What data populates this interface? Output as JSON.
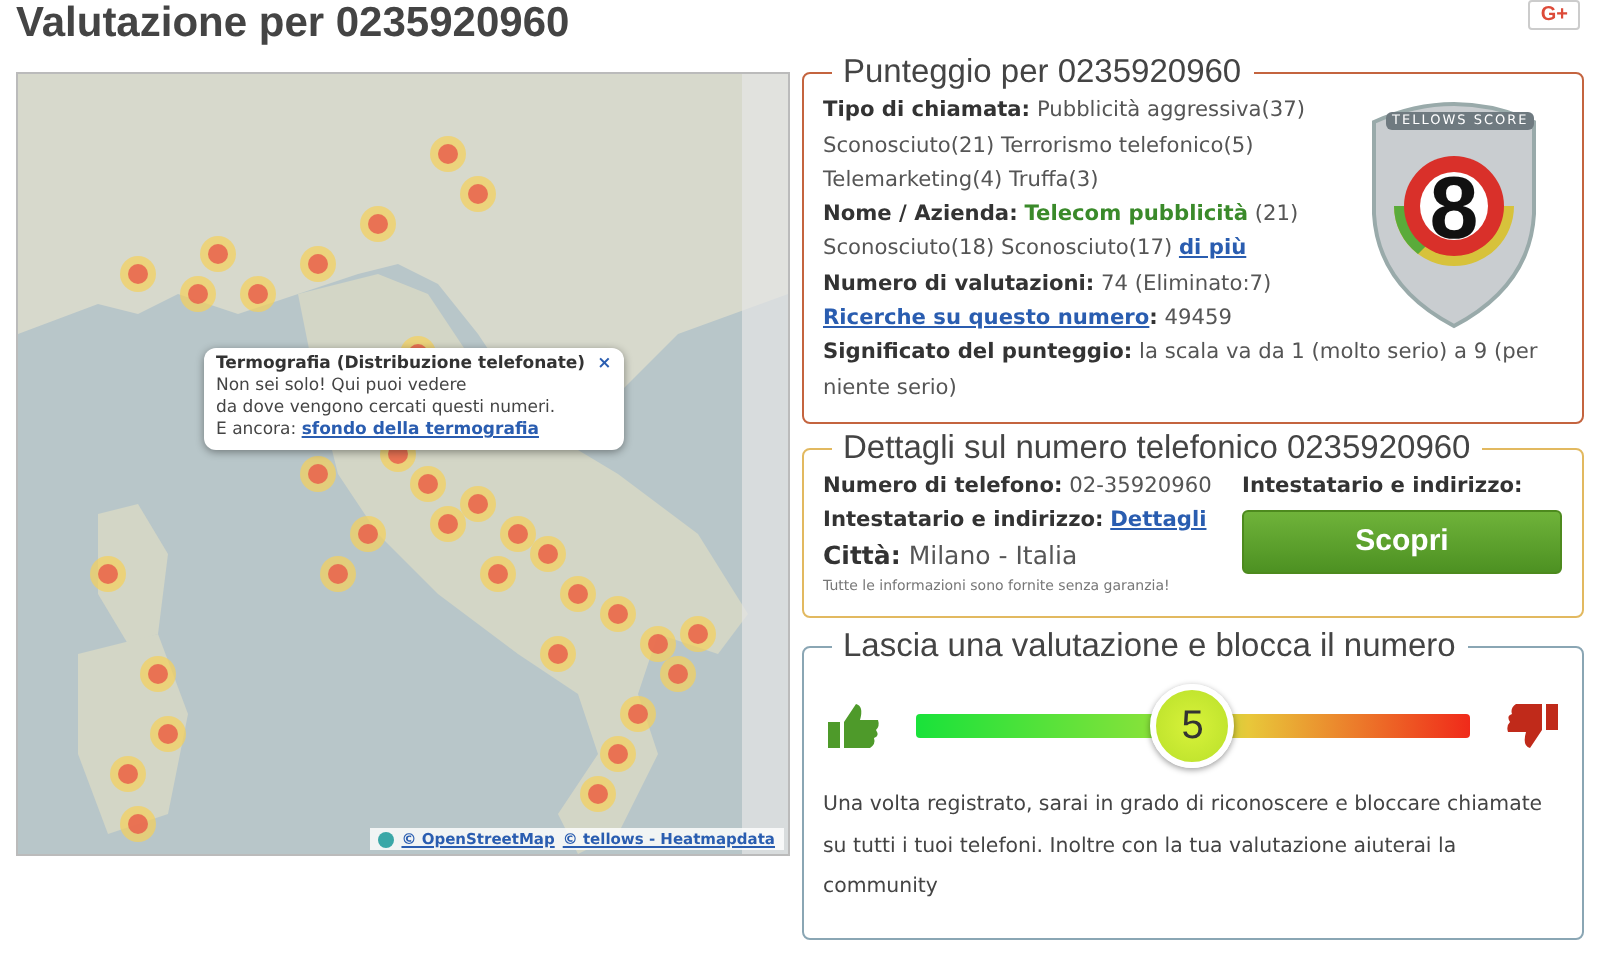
{
  "page_title": "Valutazione per 0235920960",
  "share_button": "G+",
  "map": {
    "popup": {
      "title": "Termografia (Distribuzione telefonate)",
      "close": "×",
      "lines": [
        "Non sei solo! Qui puoi vedere",
        "da dove vengono cercati questi numeri."
      ],
      "more_label": "E ancora:",
      "more_link": "sfondo della termografia"
    },
    "attribution": [
      {
        "text": "© OpenStreetMap"
      },
      {
        "text": "© tellows - Heatmapdata"
      }
    ]
  },
  "score": {
    "title": "Punteggio per 0235920960",
    "badge": {
      "caption": "TELLOWS SCORE",
      "value": "8"
    },
    "rows": [
      {
        "label": "Tipo di chiamata:",
        "text": "Pubblicità aggressiva(37) Sconosciuto(21) Terrorismo telefonico(5) Telemarketing(4) Truffa(3)",
        "label_is_link": false
      },
      {
        "label": "Nome / Azienda:",
        "name": "Telecom pubblicità",
        "text": "(21) Sconosciuto(18) Sconosciuto(17)",
        "link": "di più",
        "label_is_link": false
      },
      {
        "label": "Numero di valutazioni:",
        "text": "74 (Eliminato:7)",
        "label_is_link": false
      },
      {
        "label": "Ricerche su questo numero",
        "label_is_link": true,
        "text": ": 49459"
      },
      {
        "label": "Significato del punteggio:",
        "text": "la scala va da 1 (molto serio) a 9 (per niente serio)",
        "label_is_link": false
      }
    ]
  },
  "details": {
    "title": "Dettagli sul numero telefonico 0235920960",
    "rows": [
      {
        "label": "Numero di telefono:",
        "text": "02-35920960",
        "large": false
      },
      {
        "label": "Intestatario e indirizzo:",
        "link": "Dettagli",
        "large": false
      },
      {
        "label": "Città:",
        "text": "Milano - Italia",
        "large": true
      }
    ],
    "disclaimer": "Tutte le informazioni sono fornite senza garanzia!",
    "owner_label": "Intestatario e indirizzo:",
    "button": "Scopri"
  },
  "rating": {
    "title": "Lascia una valutazione e blocca il numero",
    "slider": {
      "level": 0.5,
      "reading": "5"
    },
    "text": "Una volta registrato, sarai in grado di riconoscere e bloccare chiamate su tutti i tuoi telefoni. Inoltre con la tua valutazione aiuterai la community"
  }
}
